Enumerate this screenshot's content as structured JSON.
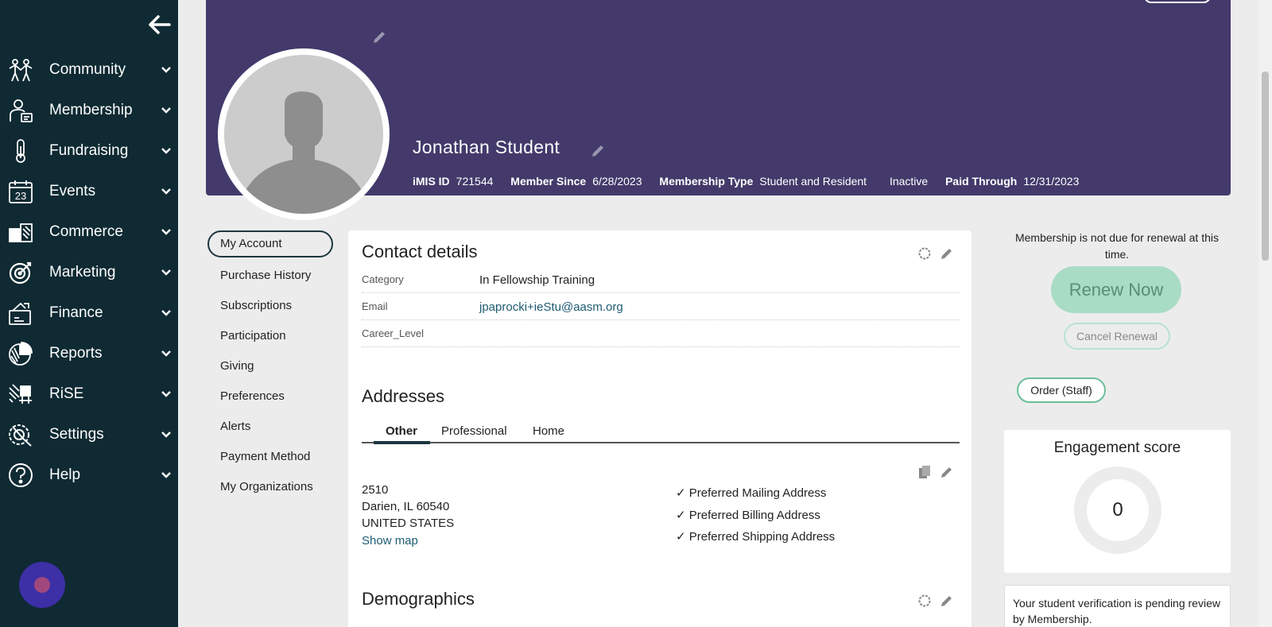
{
  "sidebar": {
    "items": [
      {
        "label": "Community",
        "icon": "community-icon"
      },
      {
        "label": "Membership",
        "icon": "membership-icon"
      },
      {
        "label": "Fundraising",
        "icon": "fundraising-icon"
      },
      {
        "label": "Events",
        "icon": "events-icon",
        "icon_text": "23"
      },
      {
        "label": "Commerce",
        "icon": "commerce-icon"
      },
      {
        "label": "Marketing",
        "icon": "marketing-icon"
      },
      {
        "label": "Finance",
        "icon": "finance-icon"
      },
      {
        "label": "Reports",
        "icon": "reports-icon"
      },
      {
        "label": "RiSE",
        "icon": "rise-icon"
      },
      {
        "label": "Settings",
        "icon": "settings-icon"
      },
      {
        "label": "Help",
        "icon": "help-icon"
      }
    ]
  },
  "profile": {
    "name": "Jonathan Student",
    "imis_id_label": "iMIS ID",
    "imis_id": "721544",
    "member_since_label": "Member Since",
    "member_since": "6/28/2023",
    "membership_type_label": "Membership Type",
    "membership_type": "Student and Resident",
    "status": "Inactive",
    "paid_through_label": "Paid Through",
    "paid_through": "12/31/2023"
  },
  "account_nav": {
    "items": [
      "My Account",
      "Purchase History",
      "Subscriptions",
      "Participation",
      "Giving",
      "Preferences",
      "Alerts",
      "Payment Method",
      "My Organizations"
    ]
  },
  "contact": {
    "title": "Contact details",
    "fields": [
      {
        "key": "Category",
        "value": "In Fellowship Training"
      },
      {
        "key": "Email",
        "value": "jpaprocki+ieStu@aasm.org"
      },
      {
        "key": "Career_Level",
        "value": ""
      }
    ]
  },
  "addresses": {
    "title": "Addresses",
    "tabs": [
      "Other",
      "Professional",
      "Home"
    ],
    "lines": [
      "2510",
      "Darien, IL 60540",
      "UNITED STATES"
    ],
    "show_map": "Show map",
    "preferences": [
      "✓ Preferred Mailing Address",
      "✓ Preferred Billing Address",
      "✓ Preferred Shipping Address"
    ]
  },
  "demographics": {
    "title": "Demographics"
  },
  "renewal": {
    "message": "Membership is not due for renewal at this time.",
    "renew_label": "Renew Now",
    "cancel_label": "Cancel Renewal"
  },
  "order_staff_label": "Order (Staff)",
  "engagement": {
    "title": "Engagement score",
    "score": "0"
  },
  "verification": {
    "message": "Your student verification is pending review by Membership."
  },
  "colors": {
    "sidebar": "#0f2a33",
    "banner": "#433a6b",
    "renew": "#a9dcc5",
    "accent_green": "#6abf99"
  }
}
